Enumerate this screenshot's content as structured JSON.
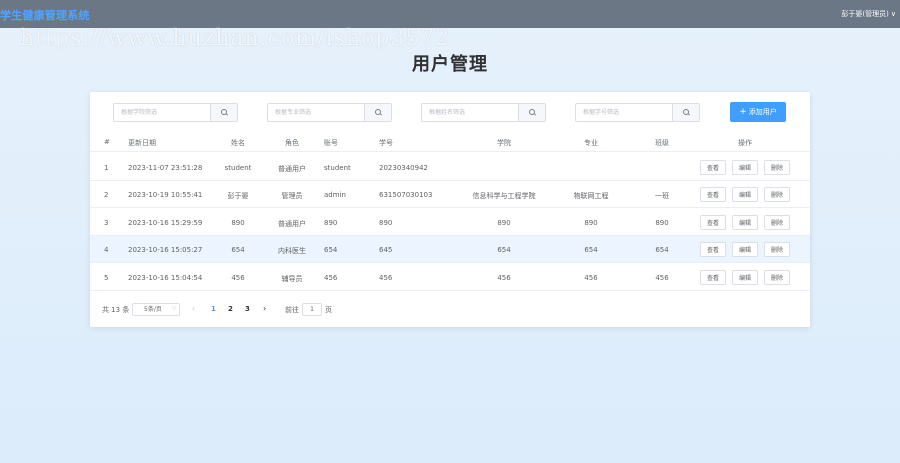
{
  "header": {
    "app_title": "学生健康管理系统",
    "user_name": "彭于晏(管理员)",
    "watermark": "https://www.huzhan.com/ishop3572"
  },
  "page": {
    "title": "用户管理"
  },
  "filters": [
    {
      "placeholder": "根据学院筛选"
    },
    {
      "placeholder": "根据专业筛选"
    },
    {
      "placeholder": "根据姓名筛选"
    },
    {
      "placeholder": "根据学号筛选"
    }
  ],
  "add_button": {
    "label": "添加用户"
  },
  "table": {
    "headers": [
      "#",
      "更新日期",
      "姓名",
      "角色",
      "账号",
      "学号",
      "学院",
      "专业",
      "班级",
      "操作"
    ],
    "rows": [
      [
        "1",
        "2023-11-07 23:51:28",
        "student",
        "普通用户",
        "student",
        "20230340942",
        "",
        "",
        ""
      ],
      [
        "2",
        "2023-10-19 10:55:41",
        "彭于晏",
        "管理员",
        "admin",
        "631507030103",
        "信息科学与工程学院",
        "物联网工程",
        "一班"
      ],
      [
        "3",
        "2023-10-16 15:29:59",
        "890",
        "普通用户",
        "890",
        "890",
        "890",
        "890",
        "890"
      ],
      [
        "4",
        "2023-10-16 15:05:27",
        "654",
        "内科医生",
        "654",
        "645",
        "654",
        "654",
        "654"
      ],
      [
        "5",
        "2023-10-16 15:04:54",
        "456",
        "辅导员",
        "456",
        "456",
        "456",
        "456",
        "456"
      ]
    ],
    "actions": {
      "view": "查看",
      "edit": "编辑",
      "delete": "删除"
    },
    "highlighted_row": 4
  },
  "pagination": {
    "total": "共 13 条",
    "page_size": "5条/页",
    "pages": [
      "1",
      "2",
      "3"
    ],
    "current_page": "1",
    "goto_label": "前往",
    "goto_value": "1",
    "page_suffix": "页"
  },
  "colors": {
    "topbar": "#6b7785",
    "accent": "#409eff",
    "highlight_row": "#ecf5ff",
    "background": "#e6f1fb"
  }
}
